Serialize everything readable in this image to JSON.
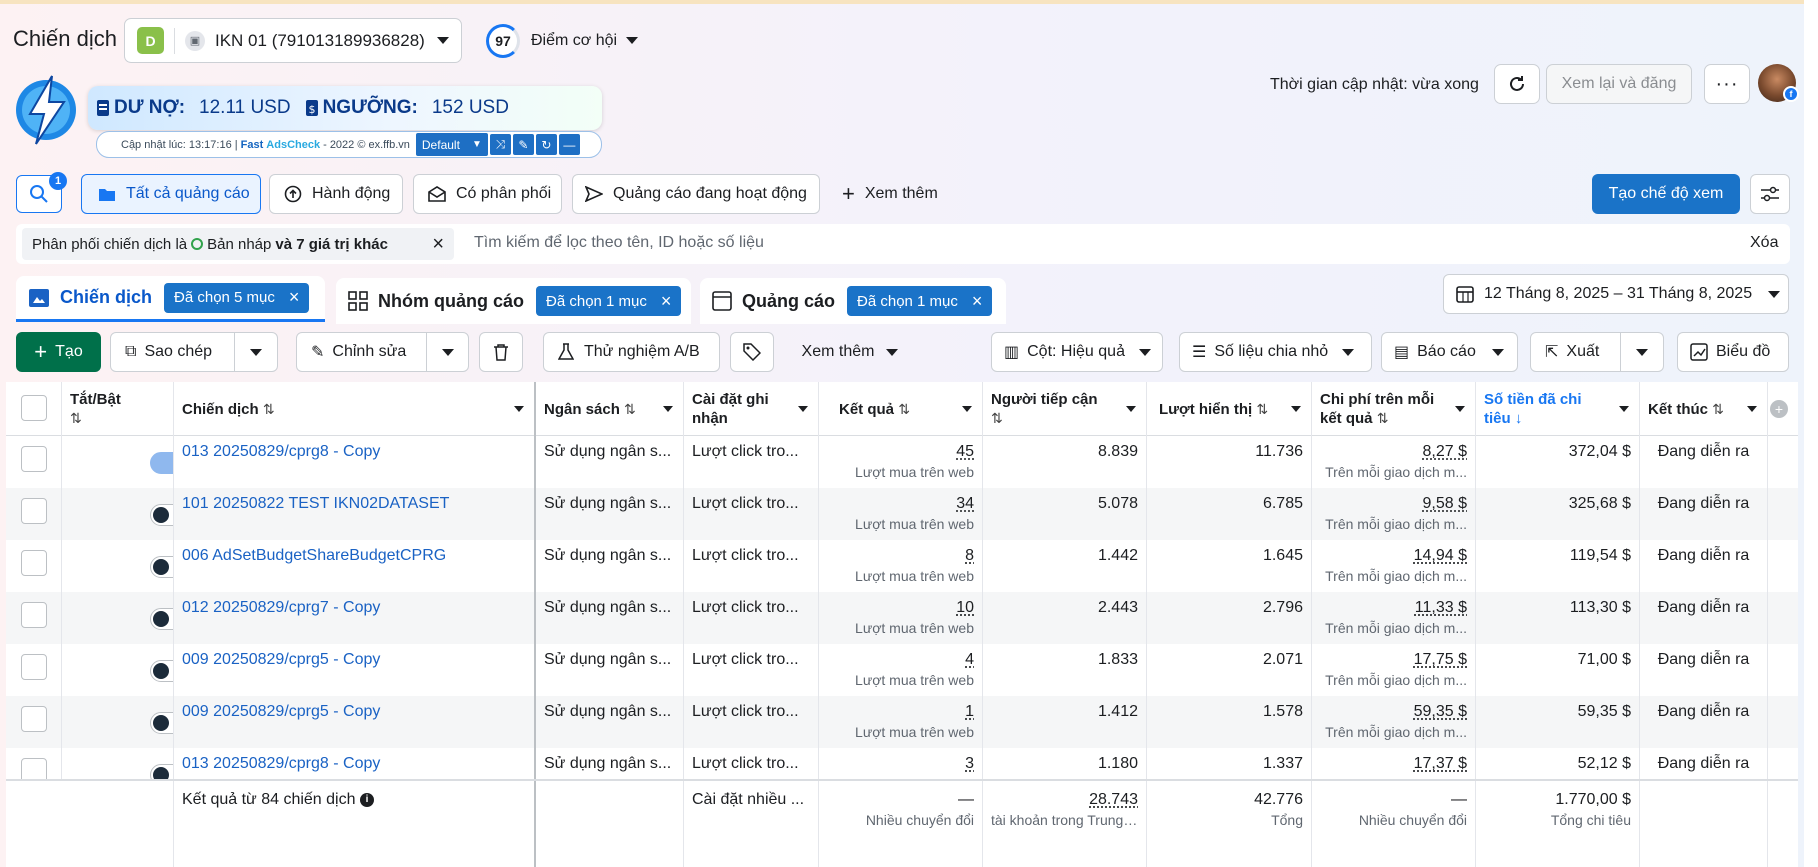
{
  "header": {
    "title": "Chiến dịch",
    "account_initial": "D",
    "account_name": "IKN 01 (791013189936828)",
    "opportunity_score": "97",
    "opportunity_label": "Điểm cơ hội",
    "update_time": "Thời gian cập nhật: vừa xong",
    "review_button": "Xem lại và đăng",
    "more_button": "···"
  },
  "extension": {
    "debt_label": "DƯ NỢ:",
    "debt_value": "12.11 USD",
    "threshold_label": "NGƯỠNG:",
    "threshold_value": "152 USD",
    "updated_at": "Cập nhật lúc: 13:17:16 |",
    "fast": "Fast",
    "adscheck": "AdsCheck",
    "copyright": "- 2022 © ex.ffb.vn",
    "select_value": "Default"
  },
  "filters": {
    "search_badge": "1",
    "all_ads": "Tất cả quảng cáo",
    "actions": "Hành động",
    "published": "Có phân phối",
    "active_ads": "Quảng cáo đang hoạt động",
    "see_more": "Xem thêm",
    "create_view": "Tạo chế độ xem",
    "chip_text": "Phân phối chiến dịch là",
    "chip_draft": "Bản nháp",
    "chip_more": "và 7 giá trị khác",
    "search_placeholder": "Tìm kiếm để lọc theo tên, ID hoặc số liệu",
    "clear": "Xóa"
  },
  "levels": {
    "campaign": "Chiến dịch",
    "campaign_sel": "Đã chọn 5 mục",
    "adset": "Nhóm quảng cáo",
    "adset_sel": "Đã chọn 1 mục",
    "ad": "Quảng cáo",
    "ad_sel": "Đã chọn 1 mục",
    "date_range": "12 Tháng 8, 2025 – 31 Tháng 8, 2025"
  },
  "toolbar": {
    "create": "Tạo",
    "copy": "Sao chép",
    "edit": "Chỉnh sửa",
    "ab_test": "Thử nghiệm A/B",
    "see_more": "Xem thêm",
    "columns": "Cột: Hiệu quả",
    "breakdown": "Số liệu chia nhỏ",
    "reports": "Báo cáo",
    "export": "Xuất",
    "chart": "Biểu đồ"
  },
  "table": {
    "headers": {
      "toggle": "Tắt/Bật",
      "campaign": "Chiến dịch",
      "budget": "Ngân sách",
      "attribution": "Cài đặt ghi nhận",
      "results": "Kết quả",
      "reach": "Người tiếp cận",
      "impressions": "Lượt hiển thị",
      "cost_per_result": "Chi phí trên mỗi kết quả",
      "amount_spent": "Số tiền đã chi tiêu",
      "ends": "Kết thúc"
    },
    "rows": [
      {
        "on": true,
        "name": "013 20250829/cprg8 - Copy",
        "budget": "Sử dụng ngân s...",
        "attr": "Lượt click tro...",
        "result": "45",
        "result_sub": "Lượt mua trên web",
        "reach": "8.839",
        "impr": "11.736",
        "cpr": "8,27 $",
        "cpr_sub": "Trên mỗi giao dịch m...",
        "spent": "372,04 $",
        "ends": "Đang diễn ra"
      },
      {
        "on": false,
        "name": "101 20250822 TEST IKN02DATASET",
        "budget": "Sử dụng ngân s...",
        "attr": "Lượt click tro...",
        "result": "34",
        "result_sub": "Lượt mua trên web",
        "reach": "5.078",
        "impr": "6.785",
        "cpr": "9,58 $",
        "cpr_sub": "Trên mỗi giao dịch m...",
        "spent": "325,68 $",
        "ends": "Đang diễn ra"
      },
      {
        "on": false,
        "name": "006 AdSetBudgetShareBudgetCPRG",
        "budget": "Sử dụng ngân s...",
        "attr": "Lượt click tro...",
        "result": "8",
        "result_sub": "Lượt mua trên web",
        "reach": "1.442",
        "impr": "1.645",
        "cpr": "14,94 $",
        "cpr_sub": "Trên mỗi giao dịch m...",
        "spent": "119,54 $",
        "ends": "Đang diễn ra"
      },
      {
        "on": false,
        "name": "012 20250829/cprg7 - Copy",
        "budget": "Sử dụng ngân s...",
        "attr": "Lượt click tro...",
        "result": "10",
        "result_sub": "Lượt mua trên web",
        "reach": "2.443",
        "impr": "2.796",
        "cpr": "11,33 $",
        "cpr_sub": "Trên mỗi giao dịch m...",
        "spent": "113,30 $",
        "ends": "Đang diễn ra"
      },
      {
        "on": false,
        "name": "009 20250829/cprg5 - Copy",
        "budget": "Sử dụng ngân s...",
        "attr": "Lượt click tro...",
        "result": "4",
        "result_sub": "Lượt mua trên web",
        "reach": "1.833",
        "impr": "2.071",
        "cpr": "17,75 $",
        "cpr_sub": "Trên mỗi giao dịch m...",
        "spent": "71,00 $",
        "ends": "Đang diễn ra"
      },
      {
        "on": false,
        "name": "009 20250829/cprg5 - Copy",
        "budget": "Sử dụng ngân s...",
        "attr": "Lượt click tro...",
        "result": "1",
        "result_sub": "Lượt mua trên web",
        "reach": "1.412",
        "impr": "1.578",
        "cpr": "59,35 $",
        "cpr_sub": "Trên mỗi giao dịch m...",
        "spent": "59,35 $",
        "ends": "Đang diễn ra"
      },
      {
        "on": false,
        "name": "013 20250829/cprg8 - Copy",
        "budget": "Sử dụng ngân s...",
        "attr": "Lượt click tro...",
        "result": "3",
        "result_sub": "",
        "reach": "1.180",
        "impr": "1.337",
        "cpr": "17,37 $",
        "cpr_sub": "",
        "spent": "52,12 $",
        "ends": "Đang diễn ra"
      }
    ],
    "totals": {
      "label": "Kết quả từ 84 chiến dịch",
      "attr": "Cài đặt nhiều ...",
      "result": "—",
      "result_sub": "Nhiều chuyển đổi",
      "reach": "28.743",
      "reach_sub": "tài khoản trong Trung ...",
      "impr": "42.776",
      "impr_sub": "Tổng",
      "cpr": "—",
      "cpr_sub": "Nhiều chuyển đổi",
      "spent": "1.770,00 $",
      "spent_sub": "Tổng chi tiêu"
    }
  }
}
